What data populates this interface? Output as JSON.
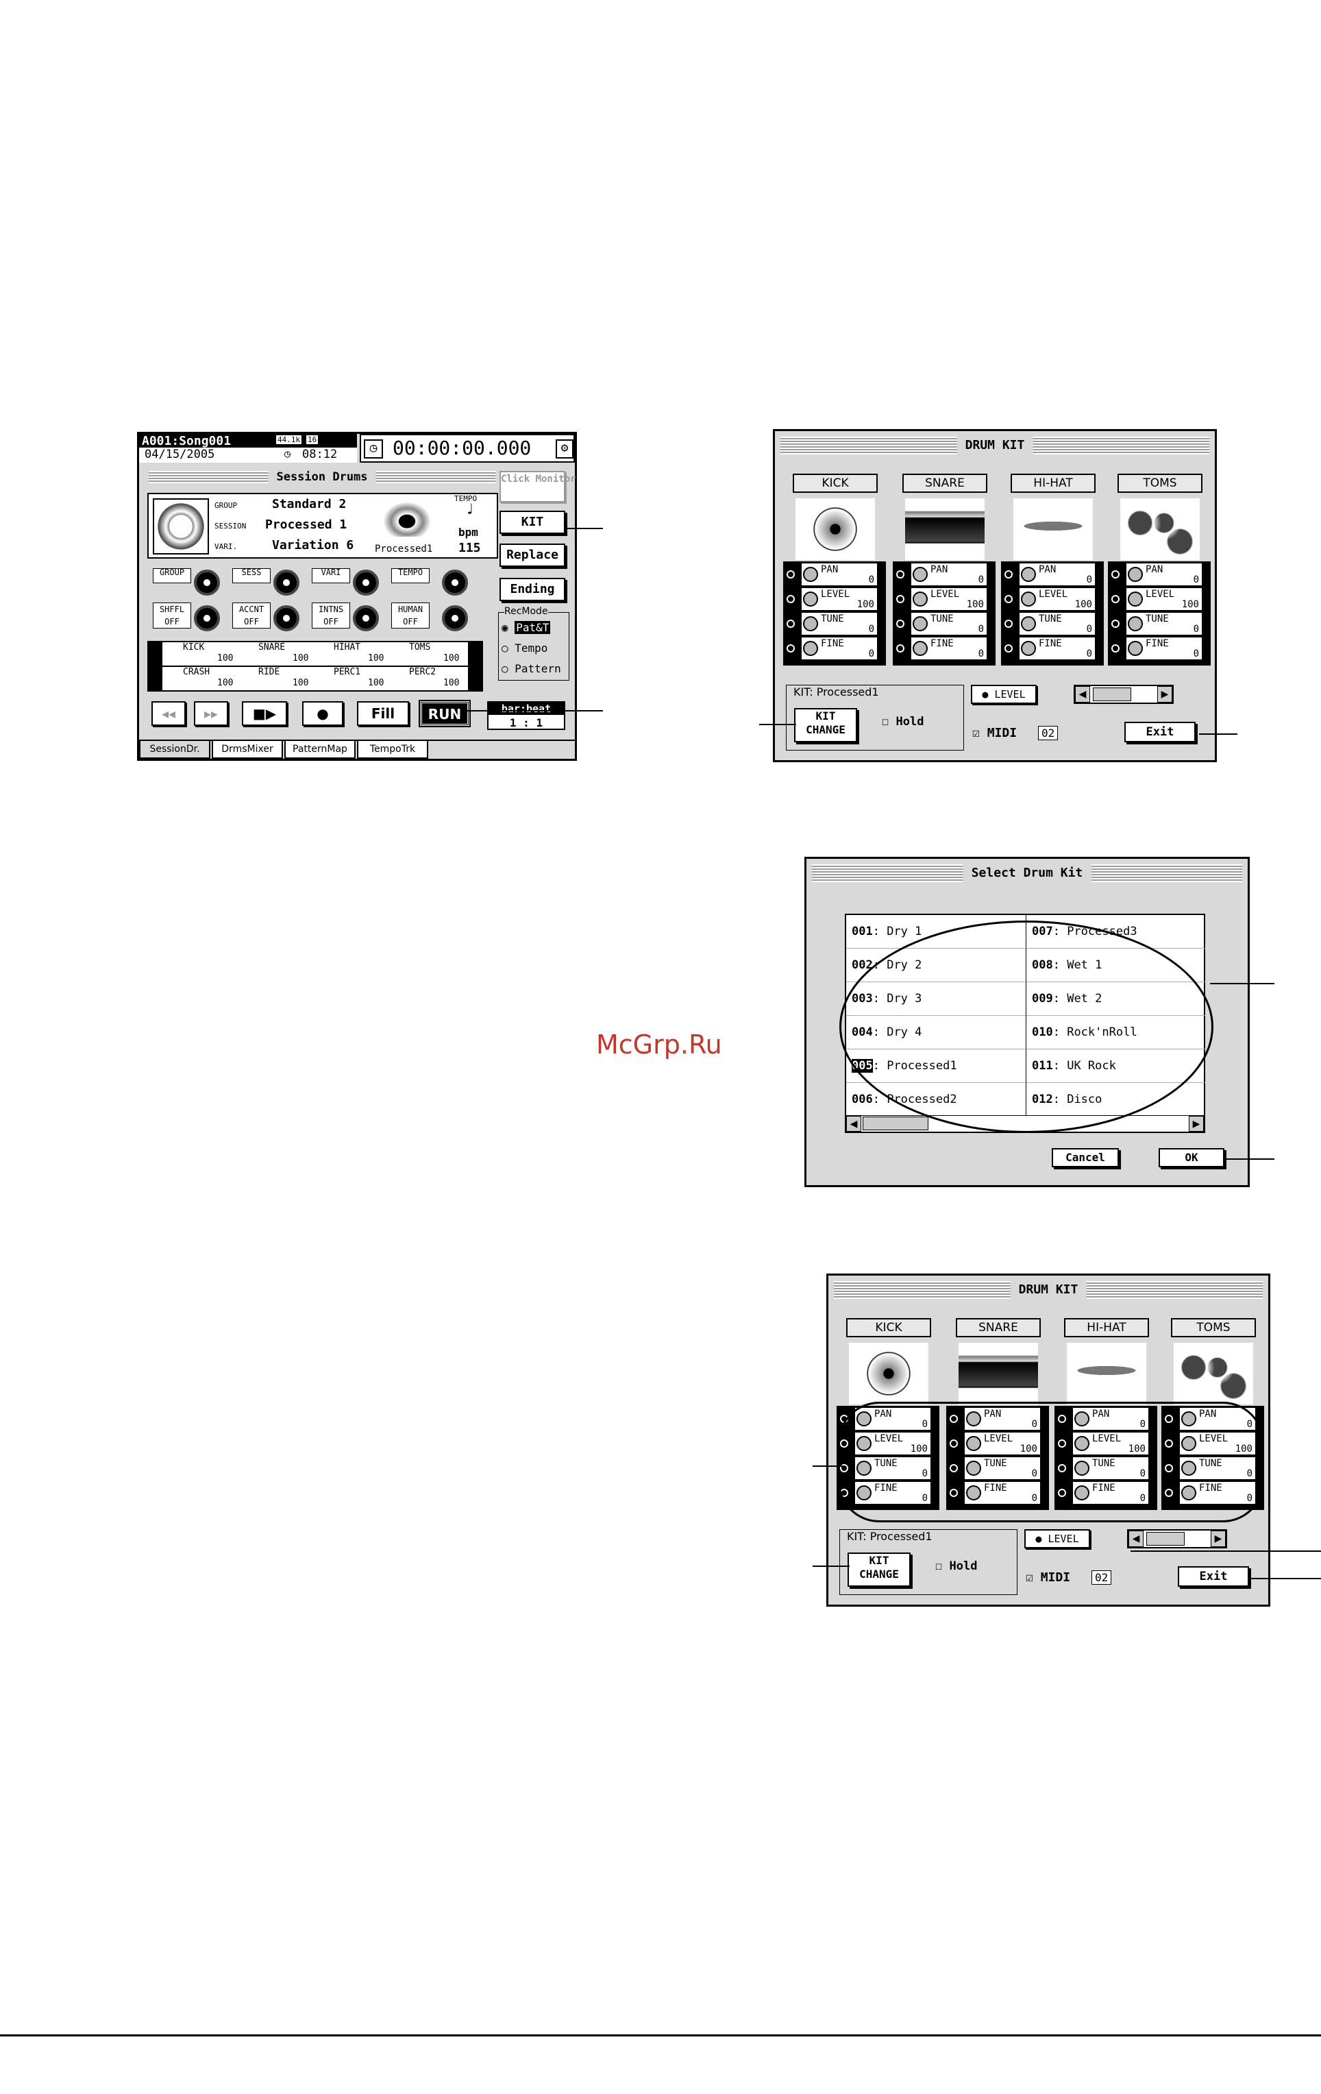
{
  "watermark": "McGrp.Ru",
  "session_screen": {
    "song": "A001:Song001",
    "rate": "44.1k",
    "bits": "16",
    "date": "04/15/2005",
    "clock": "08:12",
    "time": "00:00:00.000",
    "title": "Session Drums",
    "click_monitor": "Click Monitor",
    "group_label": "GROUP",
    "group_value": "Standard 2",
    "session_label": "SESSION",
    "session_value": "Processed 1",
    "vari_label": "VARI.",
    "vari_value": "Variation 6",
    "kit_name": "Processed1",
    "tempo_label": "TEMPO",
    "bpm_label": "bpm",
    "tempo_value": "115",
    "knobs_row1": [
      "GROUP",
      "SESS",
      "VARI",
      "TEMPO"
    ],
    "knobs_row2": [
      {
        "label": "SHFFL",
        "value": "OFF"
      },
      {
        "label": "ACCNT",
        "value": "OFF"
      },
      {
        "label": "INTNS",
        "value": "OFF"
      },
      {
        "label": "HUMAN",
        "value": "OFF"
      }
    ],
    "levels_row1": [
      {
        "name": "KICK",
        "value": "100"
      },
      {
        "name": "SNARE",
        "value": "100"
      },
      {
        "name": "HIHAT",
        "value": "100"
      },
      {
        "name": "TOMS",
        "value": "100"
      }
    ],
    "levels_row2": [
      {
        "name": "CRASH",
        "value": "100"
      },
      {
        "name": "RIDE",
        "value": "100"
      },
      {
        "name": "PERC1",
        "value": "100"
      },
      {
        "name": "PERC2",
        "value": "100"
      }
    ],
    "buttons": {
      "kit": "KIT",
      "replace": "Replace",
      "ending": "Ending",
      "fill": "Fill",
      "run": "RUN"
    },
    "recmode_label": "RecMode",
    "recmode_options": [
      "Pat&T",
      "Tempo",
      "Pattern"
    ],
    "barbeat_label": "bar:beat",
    "barbeat_value": "1 :  1",
    "tabs": [
      "SessionDr.",
      "DrmsMixer",
      "PatternMap",
      "TempoTrk"
    ]
  },
  "drum_kit": {
    "title": "DRUM KIT",
    "parts": [
      {
        "name": "KICK",
        "icon": "kick-drum-icon"
      },
      {
        "name": "SNARE",
        "icon": "snare-drum-icon"
      },
      {
        "name": "HI-HAT",
        "icon": "hihat-icon"
      },
      {
        "name": "TOMS",
        "icon": "toms-icon"
      }
    ],
    "params": [
      {
        "name": "PAN",
        "value": "0"
      },
      {
        "name": "LEVEL",
        "value": "100"
      },
      {
        "name": "TUNE",
        "value": "0"
      },
      {
        "name": "FINE",
        "value": "0"
      }
    ],
    "kit_label": "KIT: Processed1",
    "level_button": "LEVEL",
    "kit_change": "KIT CHANGE",
    "hold": "Hold",
    "midi": "MIDI",
    "midi_channel": "02",
    "exit": "Exit"
  },
  "select_kit": {
    "title": "Select Drum Kit",
    "items": [
      {
        "num": "001",
        "name": "Dry 1"
      },
      {
        "num": "002",
        "name": "Dry 2"
      },
      {
        "num": "003",
        "name": "Dry 3"
      },
      {
        "num": "004",
        "name": "Dry 4"
      },
      {
        "num": "005",
        "name": "Processed1",
        "selected": true
      },
      {
        "num": "006",
        "name": "Processed2"
      },
      {
        "num": "007",
        "name": "Processed3"
      },
      {
        "num": "008",
        "name": "Wet 1"
      },
      {
        "num": "009",
        "name": "Wet 2"
      },
      {
        "num": "010",
        "name": "Rock'nRoll"
      },
      {
        "num": "011",
        "name": "UK Rock"
      },
      {
        "num": "012",
        "name": "Disco"
      }
    ],
    "cancel": "Cancel",
    "ok": "OK"
  }
}
